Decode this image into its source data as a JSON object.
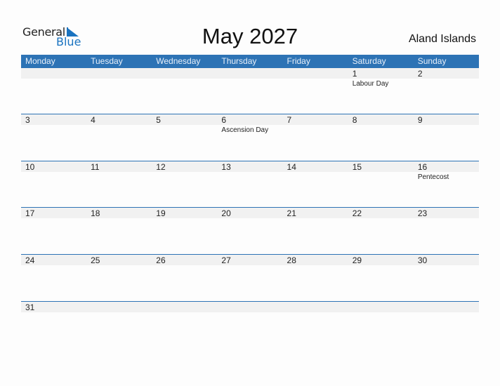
{
  "logo": {
    "line1": "General",
    "line2": "Blue"
  },
  "title": "May 2027",
  "country": "Aland Islands",
  "colors": {
    "accent": "#2d73b5",
    "band": "#f1f1f1",
    "logo_blue": "#1a73c0"
  },
  "weekdays": [
    "Monday",
    "Tuesday",
    "Wednesday",
    "Thursday",
    "Friday",
    "Saturday",
    "Sunday"
  ],
  "weeks": [
    [
      {
        "day": ""
      },
      {
        "day": ""
      },
      {
        "day": ""
      },
      {
        "day": ""
      },
      {
        "day": ""
      },
      {
        "day": "1",
        "event": "Labour Day"
      },
      {
        "day": "2"
      }
    ],
    [
      {
        "day": "3"
      },
      {
        "day": "4"
      },
      {
        "day": "5"
      },
      {
        "day": "6",
        "event": "Ascension Day"
      },
      {
        "day": "7"
      },
      {
        "day": "8"
      },
      {
        "day": "9"
      }
    ],
    [
      {
        "day": "10"
      },
      {
        "day": "11"
      },
      {
        "day": "12"
      },
      {
        "day": "13"
      },
      {
        "day": "14"
      },
      {
        "day": "15"
      },
      {
        "day": "16",
        "event": "Pentecost"
      }
    ],
    [
      {
        "day": "17"
      },
      {
        "day": "18"
      },
      {
        "day": "19"
      },
      {
        "day": "20"
      },
      {
        "day": "21"
      },
      {
        "day": "22"
      },
      {
        "day": "23"
      }
    ],
    [
      {
        "day": "24"
      },
      {
        "day": "25"
      },
      {
        "day": "26"
      },
      {
        "day": "27"
      },
      {
        "day": "28"
      },
      {
        "day": "29"
      },
      {
        "day": "30"
      }
    ],
    [
      {
        "day": "31"
      },
      {
        "day": ""
      },
      {
        "day": ""
      },
      {
        "day": ""
      },
      {
        "day": ""
      },
      {
        "day": ""
      },
      {
        "day": ""
      }
    ]
  ]
}
